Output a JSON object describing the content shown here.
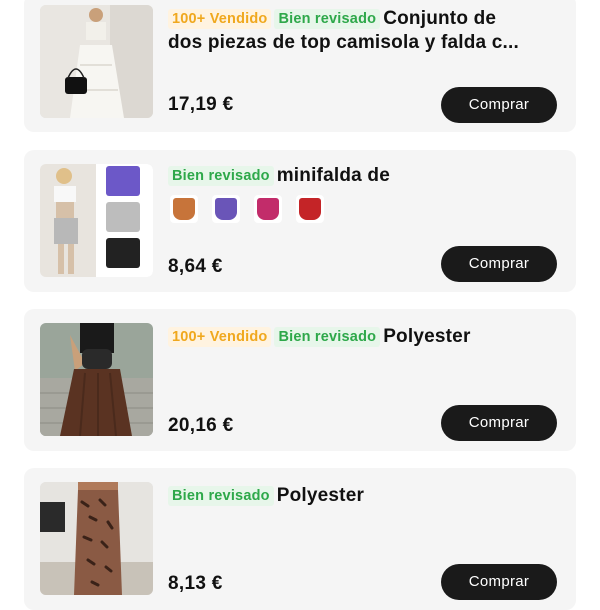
{
  "products": [
    {
      "badges": {
        "sold": "100+ Vendido",
        "reviewed": "Bien revisado"
      },
      "title_line1": "Conjunto de",
      "title_line2": "dos piezas de top camisola y falda c...",
      "price": "17,19 €",
      "buy_label": "Comprar"
    },
    {
      "badges": {
        "reviewed": "Bien revisado"
      },
      "title_line1": "minifalda de",
      "swatches": [
        {
          "name": "orange-swatch",
          "color": "#c7743a"
        },
        {
          "name": "purple-swatch",
          "color": "#6a55b8"
        },
        {
          "name": "pink-swatch",
          "color": "#c22c6a"
        },
        {
          "name": "red-swatch",
          "color": "#c42427"
        }
      ],
      "price": "8,64 €",
      "buy_label": "Comprar"
    },
    {
      "badges": {
        "sold": "100+ Vendido",
        "reviewed": "Bien revisado"
      },
      "title_line1": "Polyester",
      "price": "20,16 €",
      "buy_label": "Comprar"
    },
    {
      "badges": {
        "reviewed": "Bien revisado"
      },
      "title_line1": "Polyester",
      "price": "8,13 €",
      "buy_label": "Comprar"
    }
  ],
  "colors": {
    "card_bg": "#f5f5f5",
    "sold_badge": "#f0a81e",
    "reviewed_badge": "#2ea84a",
    "button_bg": "#1a1a1a"
  }
}
